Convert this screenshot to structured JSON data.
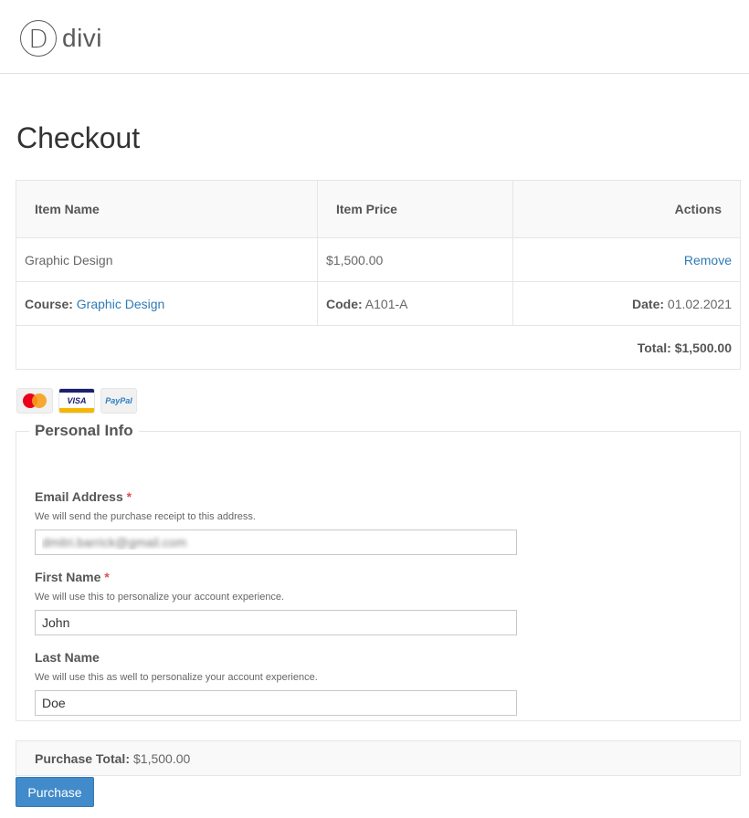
{
  "brand": {
    "mark": "D",
    "name": "divi"
  },
  "page": {
    "title": "Checkout"
  },
  "cart": {
    "headers": {
      "item_name": "Item Name",
      "item_price": "Item Price",
      "actions": "Actions"
    },
    "item": {
      "name": "Graphic Design",
      "price": "$1,500.00",
      "action": "Remove"
    },
    "meta": {
      "course_label": "Course:",
      "course_value": "Graphic Design",
      "code_label": "Code:",
      "code_value": "A101-A",
      "date_label": "Date:",
      "date_value": "01.02.2021"
    },
    "total": {
      "label": "Total:",
      "value": "$1,500.00"
    }
  },
  "payment_icons": [
    "mastercard-icon",
    "visa-icon",
    "paypal-icon"
  ],
  "payment": {
    "mc_text": "mastercard",
    "visa_text": "VISA",
    "paypal_text": "PayPal"
  },
  "personal_info": {
    "legend": "Personal Info",
    "email": {
      "label": "Email Address",
      "required": "*",
      "description": "We will send the purchase receipt to this address.",
      "value": "dmitri.barrick@gmail.com"
    },
    "first_name": {
      "label": "First Name",
      "required": "*",
      "description": "We will use this to personalize your account experience.",
      "value": "John"
    },
    "last_name": {
      "label": "Last Name",
      "description": "We will use this as well to personalize your account experience.",
      "value": "Doe"
    }
  },
  "purchase_total": {
    "label": "Purchase Total:",
    "value": "$1,500.00"
  },
  "purchase_button": {
    "label": "Purchase"
  },
  "colors": {
    "link": "#2e7bb6",
    "button": "#428bca",
    "required": "#d9534f"
  }
}
